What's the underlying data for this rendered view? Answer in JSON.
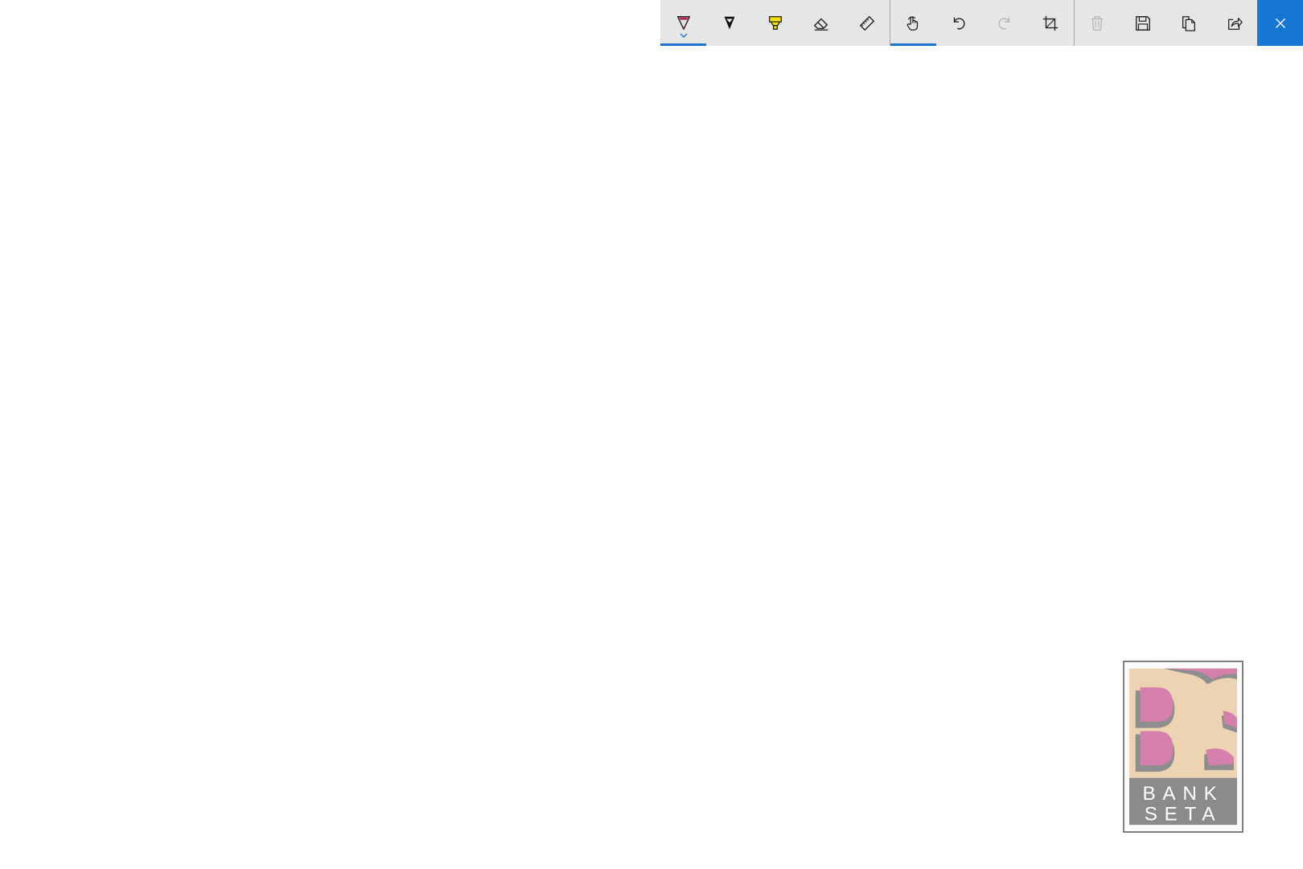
{
  "toolbar": {
    "ink_group": [
      {
        "name": "ballpoint-pen",
        "icon": "pen-icon",
        "color": "#c2185b",
        "selected": true
      },
      {
        "name": "pencil",
        "icon": "pencil-icon",
        "color": "#111111",
        "selected": false
      },
      {
        "name": "highlighter",
        "icon": "highlighter-icon",
        "color": "#f5e100",
        "selected": false
      },
      {
        "name": "eraser",
        "icon": "eraser-icon",
        "selected": false
      },
      {
        "name": "ruler",
        "icon": "ruler-icon",
        "selected": false
      }
    ],
    "edit_group": [
      {
        "name": "touch-writing",
        "icon": "touch-icon",
        "selected": true
      },
      {
        "name": "undo",
        "icon": "undo-icon",
        "disabled": false
      },
      {
        "name": "redo",
        "icon": "redo-icon",
        "disabled": true
      },
      {
        "name": "crop",
        "icon": "crop-icon",
        "disabled": false
      }
    ],
    "file_group": [
      {
        "name": "delete",
        "icon": "trash-icon",
        "disabled": true
      },
      {
        "name": "save",
        "icon": "save-icon",
        "disabled": false
      },
      {
        "name": "copy",
        "icon": "copy-icon",
        "disabled": false
      },
      {
        "name": "share",
        "icon": "share-icon",
        "disabled": false
      }
    ],
    "close": {
      "icon": "close-icon",
      "color": "#1676d4"
    }
  },
  "logo": {
    "line1": "BANK",
    "line2": "SETA",
    "colors": {
      "background": "#ecd4b3",
      "letters": "#d57fac",
      "shadow": "#8e8e8e",
      "band": "#8b8b8b"
    }
  }
}
